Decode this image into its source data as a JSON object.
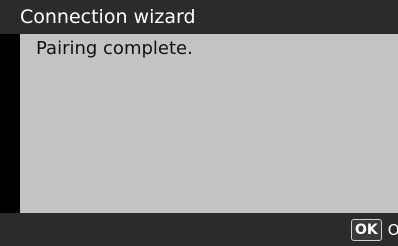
{
  "window": {
    "title": "Connection wizard"
  },
  "content": {
    "message": "Pairing complete."
  },
  "footer": {
    "ok_badge": "OK",
    "ok_label": "OK"
  },
  "colors": {
    "title_bar": "#2b2b2b",
    "content_background": "#c3c3c3",
    "left_margin": "#000000",
    "text_light": "#ffffff",
    "text_dark": "#111111"
  }
}
